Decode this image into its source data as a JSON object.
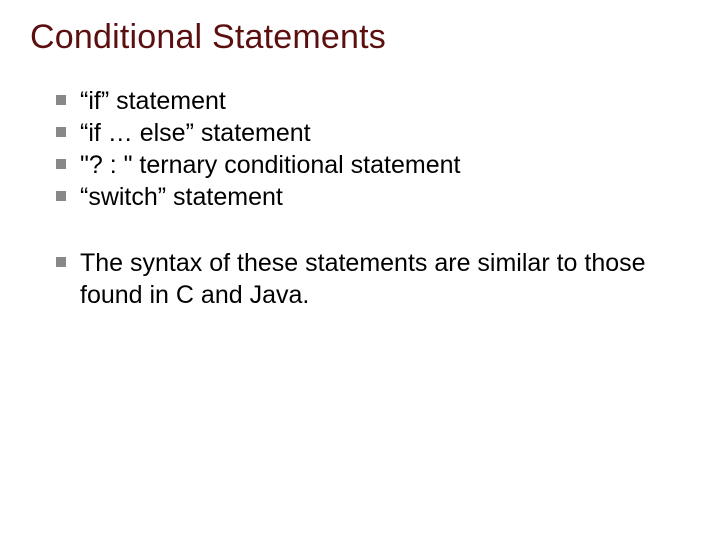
{
  "title": "Conditional Statements",
  "bullets": {
    "b0": "“if” statement",
    "b1": "“if … else” statement",
    "b2": "\"? : \" ternary conditional statement",
    "b3": "“switch” statement"
  },
  "note": "The syntax of these statements are similar to those found in C and Java."
}
